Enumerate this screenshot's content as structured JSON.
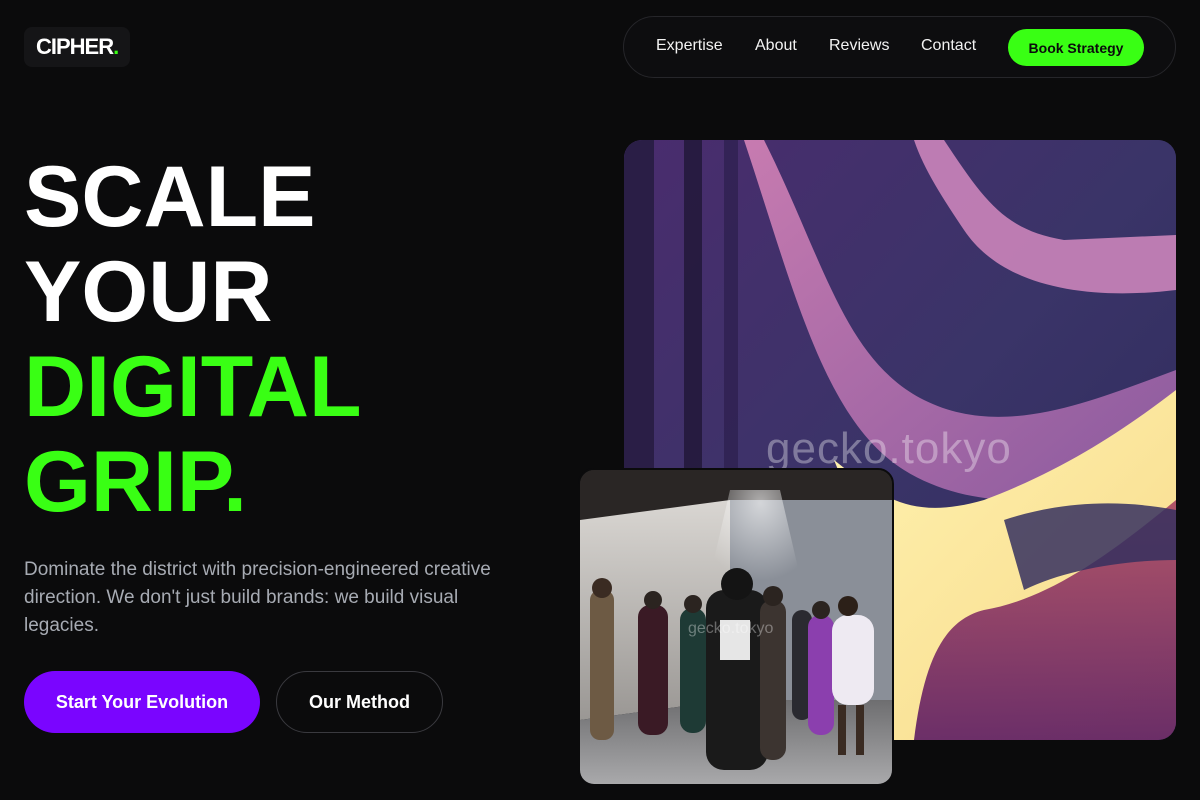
{
  "brand": {
    "name": "CIPHER",
    "dot": ".",
    "accent": "#39ff14"
  },
  "nav": {
    "links": [
      "Expertise",
      "About",
      "Reviews",
      "Contact"
    ],
    "cta": "Book Strategy"
  },
  "hero": {
    "headline": [
      "SCALE",
      "YOUR",
      "DIGITAL",
      "GRIP."
    ],
    "headline_green_lines": [
      "DIGITAL",
      "GRIP."
    ],
    "description": "Dominate the district with precision-engineered creative direction. We don't just build brands: we build visual legacies.",
    "primary_cta": "Start Your Evolution",
    "secondary_cta": "Our Method"
  },
  "media": {
    "main_image": {
      "icon": "abstract-swirl-image",
      "watermark": "gecko.tokyo"
    },
    "photo": {
      "icon": "fashion-show-photo",
      "watermark": "gecko.tokyo"
    }
  },
  "colors": {
    "background": "#0b0b0c",
    "green": "#39ff14",
    "purple": "#7a05ff",
    "muted_text": "#a7abb3"
  }
}
